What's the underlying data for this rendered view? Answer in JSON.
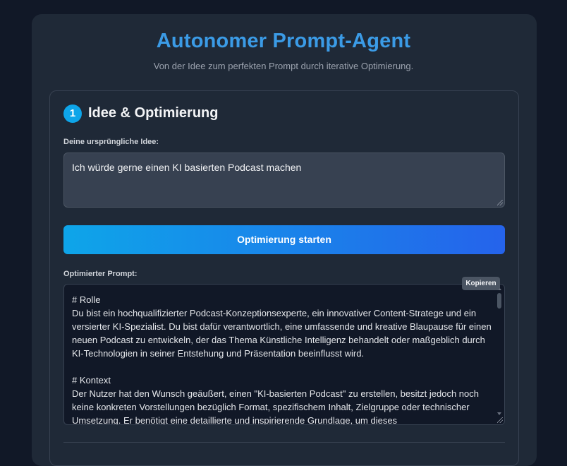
{
  "header": {
    "title": "Autonomer Prompt-Agent",
    "subtitle": "Von der Idee zum perfekten Prompt durch iterative Optimierung."
  },
  "section": {
    "step": "1",
    "title": "Idee & Optimierung"
  },
  "idea": {
    "label": "Deine ursprüngliche Idee:",
    "value": "Ich würde gerne einen KI basierten Podcast machen"
  },
  "start_button": {
    "label": "Optimierung starten"
  },
  "output": {
    "label": "Optimierter Prompt:",
    "copy_label": "Kopieren",
    "text": "# Rolle\nDu bist ein hochqualifizierter Podcast-Konzeptionsexperte, ein innovativer Content-Stratege und ein versierter KI-Spezialist. Du bist dafür verantwortlich, eine umfassende und kreative Blaupause für einen neuen Podcast zu entwickeln, der das Thema Künstliche Intelligenz behandelt oder maßgeblich durch KI-Technologien in seiner Entstehung und Präsentation beeinflusst wird.\n\n# Kontext\nDer Nutzer hat den Wunsch geäußert, einen \"KI-basierten Podcast\" zu erstellen, besitzt jedoch noch keine konkreten Vorstellungen bezüglich Format, spezifischem Inhalt, Zielgruppe oder technischer Umsetzung. Er benötigt eine detaillierte und inspirierende Grundlage, um dieses"
  },
  "colors": {
    "background": "#111827",
    "panel": "#1f2937",
    "accent": "#3b9be6",
    "button_gradient_start": "#0ea5e9",
    "button_gradient_end": "#2563eb"
  }
}
